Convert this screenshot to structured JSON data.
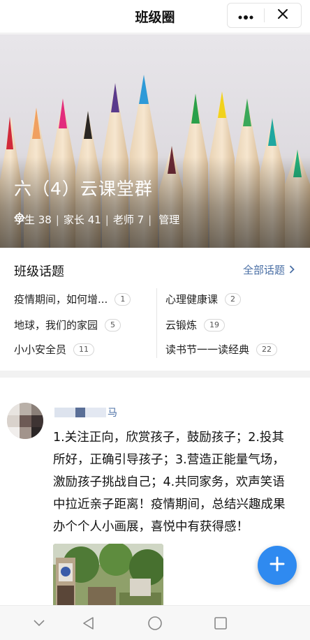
{
  "header": {
    "title": "班级圈",
    "more_icon": "more-dots-icon",
    "close_icon": "close-icon"
  },
  "hero": {
    "group_name": "六（4）云课堂群",
    "students": "学生 38",
    "parents": "家长 41",
    "teachers": "老师 7",
    "separator": "|",
    "manage_label": "管理",
    "manage_icon": "gear-icon"
  },
  "topics": {
    "title": "班级话题",
    "all_label": "全部话题",
    "items": [
      {
        "label": "疫情期间，如何增...",
        "count": "1"
      },
      {
        "label": "心理健康课",
        "count": "2"
      },
      {
        "label": "地球，我们的家园",
        "count": "5"
      },
      {
        "label": "云锻炼",
        "count": "19"
      },
      {
        "label": "小小安全员",
        "count": "11"
      },
      {
        "label": "读书节一一读经典",
        "count": "22"
      }
    ]
  },
  "post": {
    "author_suffix": "马",
    "text": "1.关注正向，欣赏孩子，鼓励孩子；2.投其所好，正确引导孩子；3.营造正能量气场，激励孩子挑战自己；4.共同家务，欢声笑语中拉近亲子距离！疫情期间，总结兴趣成果办个个人小画展，喜悦中有获得感！"
  },
  "fab": {
    "icon": "plus-icon"
  },
  "nav": {
    "icons": [
      "chevron-down-icon",
      "back-triangle-icon",
      "home-circle-icon",
      "recents-square-icon"
    ]
  },
  "colors": {
    "accent_link": "#4a6fa5",
    "fab": "#2f8af0"
  }
}
